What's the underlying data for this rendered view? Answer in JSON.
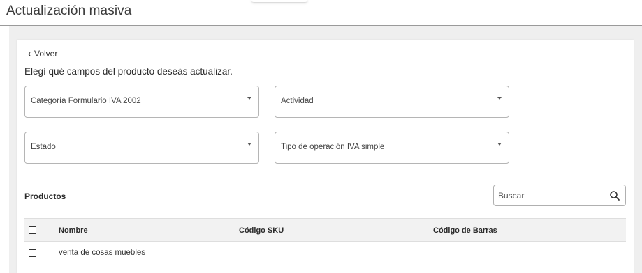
{
  "header": {
    "title": "Actualización masiva"
  },
  "back": {
    "label": "Volver"
  },
  "instruction": "Elegí qué campos del producto deseás actualizar.",
  "fields": {
    "categoria": "Categoría Formulario IVA 2002",
    "actividad": "Actividad",
    "estado": "Estado",
    "tipo_operacion": "Tipo de operación IVA simple"
  },
  "products": {
    "title": "Productos",
    "search_placeholder": "Buscar",
    "columns": {
      "nombre": "Nombre",
      "sku": "Código SKU",
      "barras": "Código de Barras"
    },
    "rows": [
      {
        "nombre": "venta de cosas muebles",
        "sku": "",
        "barras": ""
      }
    ]
  }
}
